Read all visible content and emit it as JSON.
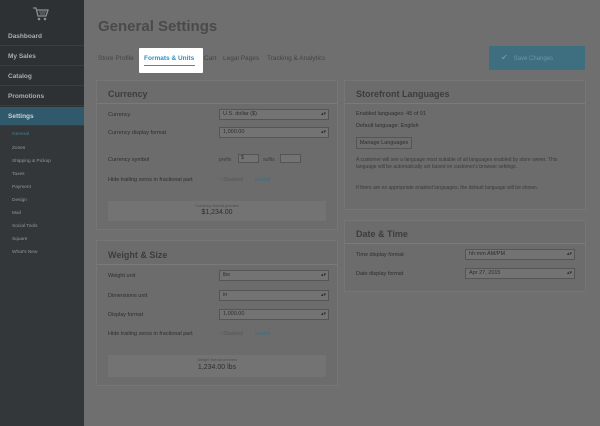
{
  "sidebar": {
    "logo_icon": "shopping-cart-icon",
    "items": [
      {
        "label": "Dashboard"
      },
      {
        "label": "My Sales"
      },
      {
        "label": "Catalog"
      },
      {
        "label": "Promotions"
      },
      {
        "label": "Settings"
      }
    ],
    "sub_items": [
      {
        "label": "General"
      },
      {
        "label": "Zones"
      },
      {
        "label": "Shipping & Pickup"
      },
      {
        "label": "Taxes"
      },
      {
        "label": "Payment"
      },
      {
        "label": "Design"
      },
      {
        "label": "Mail"
      },
      {
        "label": "Social Tools"
      },
      {
        "label": "Square"
      },
      {
        "label": "What's New"
      }
    ]
  },
  "header": {
    "title": "General Settings",
    "tabs": [
      {
        "label": "Store Profile"
      },
      {
        "label": "Formats & Units"
      },
      {
        "label": "Cart"
      },
      {
        "label": "Legal Pages"
      },
      {
        "label": "Tracking & Analytics"
      }
    ],
    "save_label": "Save Changes"
  },
  "currency": {
    "title": "Currency",
    "currency_label": "Currency",
    "currency_value": "U.S. dollar ($)",
    "display_format_label": "Currency display format",
    "display_format_value": "1,000.00",
    "symbol_label": "Currency symbol",
    "prefix_label": "prefix",
    "prefix_value": "$",
    "suffix_label": "suffix",
    "suffix_value": "",
    "hide_zeros_label": "Hide trailing zeros in fractional part",
    "disabled_label": "Disabled",
    "enable_label": "Enable",
    "preview_label": "Currency format preview",
    "preview_value": "$1,234.00"
  },
  "weight": {
    "title": "Weight & Size",
    "weight_unit_label": "Weight unit",
    "weight_unit_value": "lbs",
    "dimensions_label": "Dimensions unit",
    "dimensions_value": "in",
    "display_format_label": "Display format",
    "display_format_value": "1,000.00",
    "hide_zeros_label": "Hide trailing zeros in fractional part",
    "disabled_label": "Disabled",
    "enable_label": "Enable",
    "preview_label": "Weight format preview",
    "preview_value": "1,234.00 lbs"
  },
  "languages": {
    "title": "Storefront Languages",
    "enabled_text": "Enabled languages: 45 of 91",
    "default_text": "Default language: English",
    "manage_label": "Manage Languages",
    "note_1": "A customer will see a language most suitable of all languages enabled by store owner. This language will be automatically set based on customer's browser settings.",
    "note_2": "If there are no appropriate enabled languages, the default language will be shown."
  },
  "datetime": {
    "title": "Date & Time",
    "time_label": "Time display format",
    "time_value": "hh:mm AM/PM",
    "date_label": "Date display format",
    "date_value": "Apr 27, 2015"
  }
}
